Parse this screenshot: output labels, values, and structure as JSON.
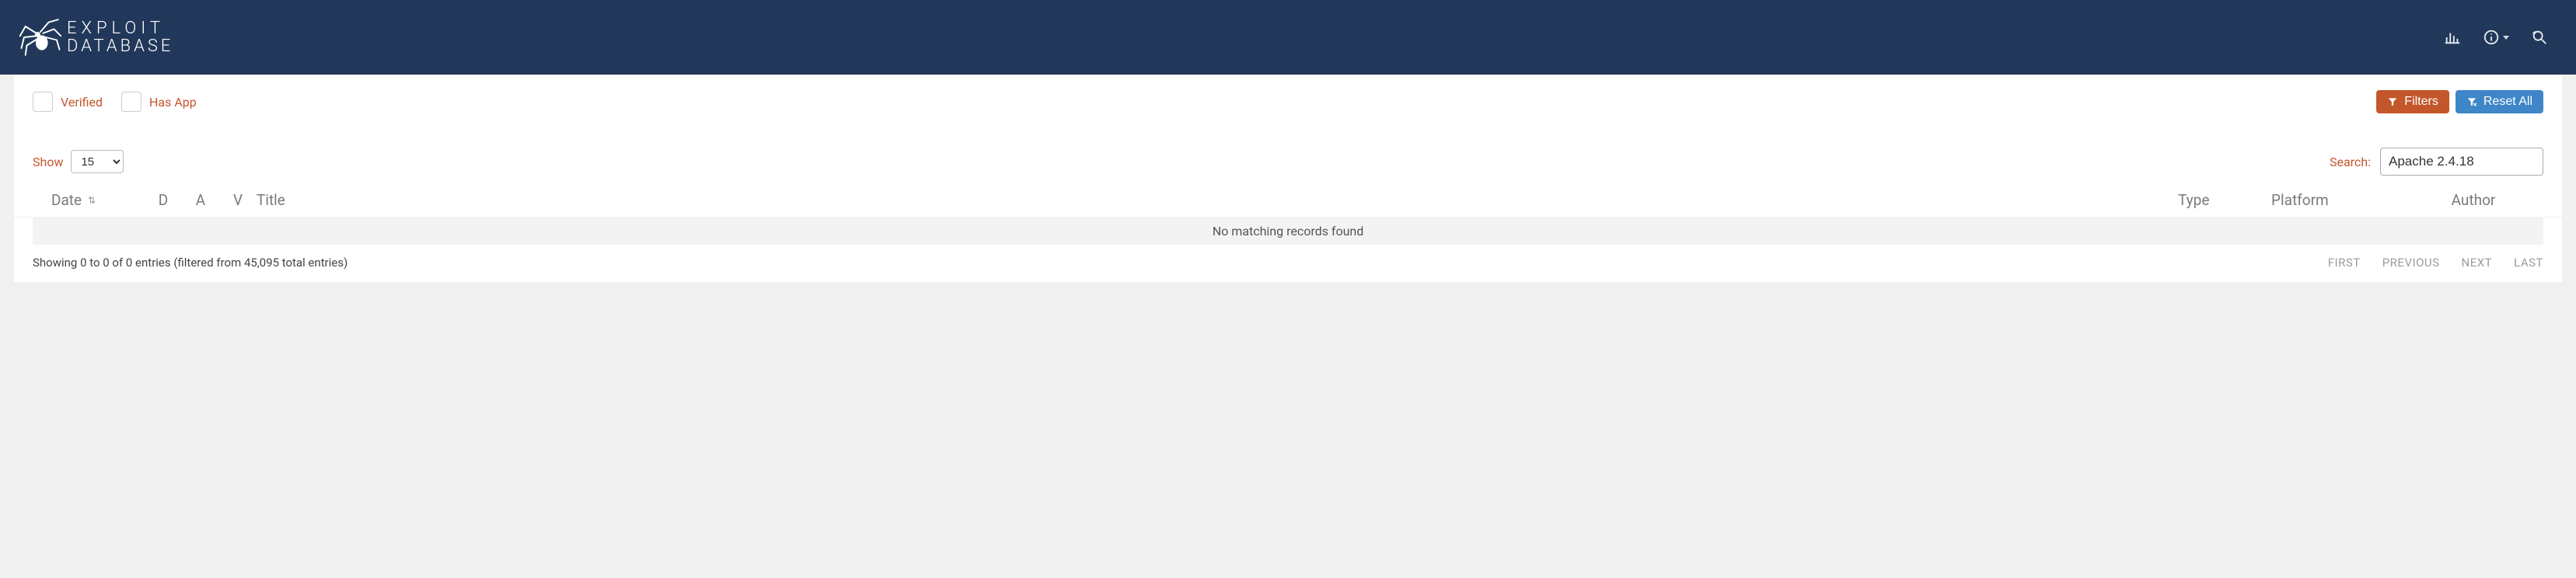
{
  "header": {
    "brand_line1": "EXPLOIT",
    "brand_line2": "DATABASE"
  },
  "filters": {
    "verified_label": "Verified",
    "hasapp_label": "Has App",
    "filters_btn": "Filters",
    "reset_btn": "Reset All"
  },
  "controls": {
    "show_label": "Show",
    "show_value": "15",
    "search_label": "Search:",
    "search_value": "Apache 2.4.18"
  },
  "columns": {
    "date": "Date",
    "d": "D",
    "a": "A",
    "v": "V",
    "title": "Title",
    "type": "Type",
    "platform": "Platform",
    "author": "Author"
  },
  "body": {
    "empty": "No matching records found",
    "info": "Showing 0 to 0 of 0 entries (filtered from 45,095 total entries)"
  },
  "pager": {
    "first": "FIRST",
    "previous": "PREVIOUS",
    "next": "NEXT",
    "last": "LAST"
  }
}
